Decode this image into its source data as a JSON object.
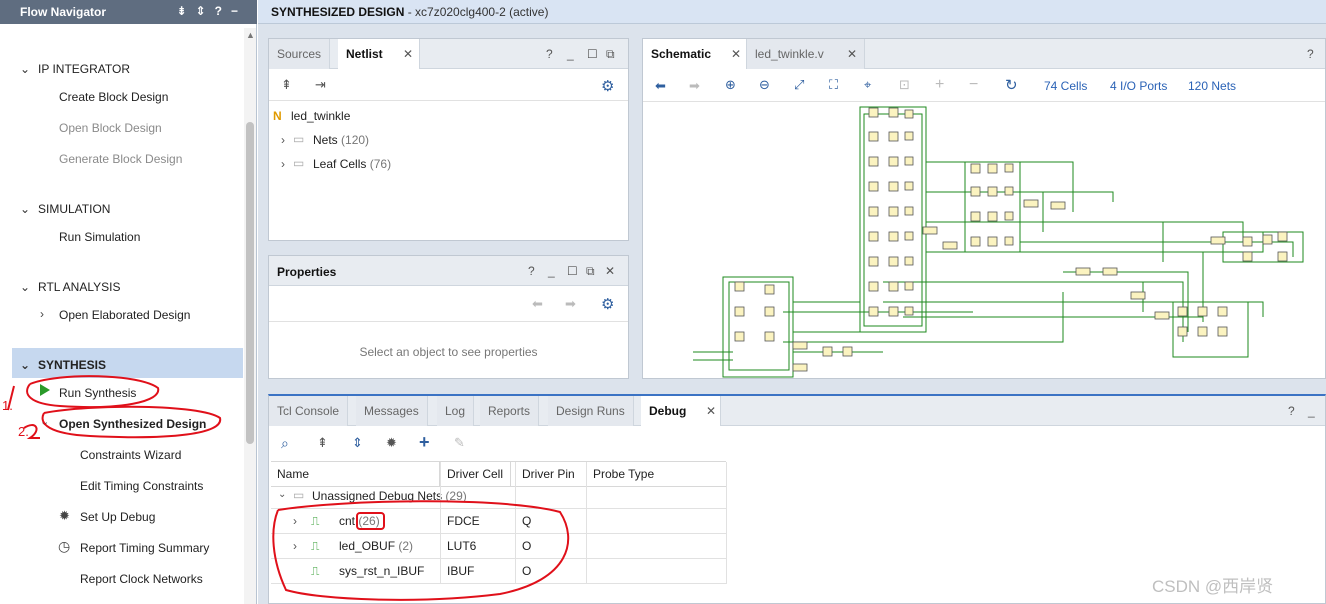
{
  "flow_nav": {
    "title": "Flow Navigator",
    "header_icons": [
      "collapse-all-icon",
      "expand-collapse-icon",
      "help-icon",
      "minimize-icon"
    ],
    "sections": {
      "ip_integrator": {
        "label": "IP INTEGRATOR",
        "items": [
          "Create Block Design",
          "Open Block Design",
          "Generate Block Design"
        ]
      },
      "simulation": {
        "label": "SIMULATION",
        "items": [
          "Run Simulation"
        ]
      },
      "rtl": {
        "label": "RTL ANALYSIS",
        "items": [
          "Open Elaborated Design"
        ]
      },
      "synthesis": {
        "label": "SYNTHESIS",
        "items": [
          "Run Synthesis",
          "Open Synthesized Design"
        ],
        "subitems": [
          "Constraints Wizard",
          "Edit Timing Constraints",
          "Set Up Debug",
          "Report Timing Summary",
          "Report Clock Networks"
        ]
      }
    }
  },
  "topbar": {
    "title": "SYNTHESIZED DESIGN",
    "part": "- xc7z020clg400-2",
    "status": "(active)"
  },
  "netlist_panel": {
    "tabs": [
      "Sources",
      "Netlist"
    ],
    "root": "led_twinkle",
    "nodes": [
      {
        "label": "Nets",
        "count": "(120)"
      },
      {
        "label": "Leaf Cells",
        "count": "(76)"
      }
    ]
  },
  "properties_panel": {
    "title": "Properties",
    "placeholder": "Select an object to see properties"
  },
  "schematic_panel": {
    "tabs": [
      "Schematic",
      "led_twinkle.v"
    ],
    "cells": "74 Cells",
    "ports": "4 I/O Ports",
    "nets": "120 Nets"
  },
  "debug_panel": {
    "tabs": [
      "Tcl Console",
      "Messages",
      "Log",
      "Reports",
      "Design Runs",
      "Debug"
    ],
    "columns": [
      "Name",
      "Driver Cell",
      "Driver Pin",
      "Probe Type"
    ],
    "group": {
      "label": "Unassigned Debug Nets",
      "count": "(29)"
    },
    "rows": [
      {
        "name": "cnt",
        "count": "(26)",
        "cell": "FDCE",
        "pin": "Q"
      },
      {
        "name": "led_OBUF",
        "count": "(2)",
        "cell": "LUT6",
        "pin": "O"
      },
      {
        "name": "sys_rst_n_IBUF",
        "count": "",
        "cell": "IBUF",
        "pin": "O"
      }
    ]
  },
  "annotations": {
    "mark1": "1.",
    "mark2": "2."
  },
  "watermark": "CSDN @西岸贤",
  "colors": {
    "accent": "#2a62b6",
    "header": "#5f6d80",
    "selection": "#c6d8ef",
    "annotation": "#e0101a",
    "run_green": "#2a9a2a"
  }
}
